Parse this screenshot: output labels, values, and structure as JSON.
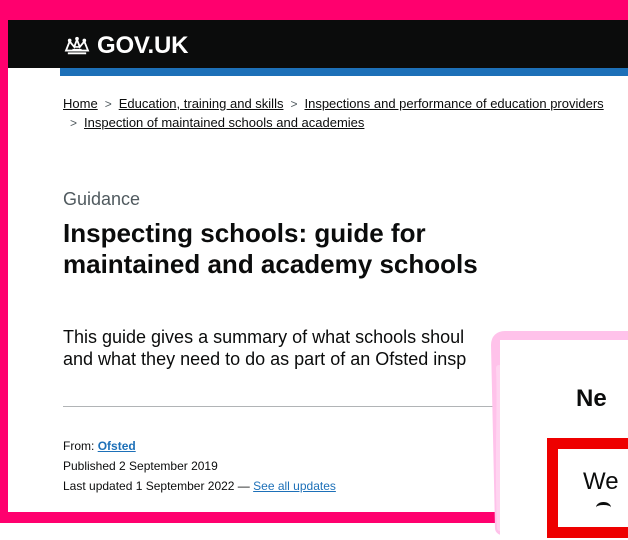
{
  "colors": {
    "frame": "#ff006e",
    "header": "#0b0c0c",
    "header_accent": "#1d70b8",
    "link": "#1d70b8",
    "popup_outline": "#ffc2ea",
    "popup_box_border": "#ee0000"
  },
  "header": {
    "logo_text": "GOV.UK",
    "logo_icon": "crown-icon"
  },
  "breadcrumbs": [
    "Home",
    "Education, training and skills",
    "Inspections and performance of education providers",
    "Inspection of maintained schools and academies"
  ],
  "document": {
    "type": "Guidance",
    "title": "Inspecting schools: guide for maintained and academy schools",
    "lead_line_1": "This guide gives a summary of what schools shoul",
    "lead_line_2": "and what they need to do as part of an Ofsted insp"
  },
  "meta": {
    "from_label": "From:",
    "from_value": "Ofsted",
    "published": "Published 2 September 2019",
    "last_updated": "Last updated 1 September 2022 —",
    "updates_link": "See all updates"
  },
  "popup": {
    "title": "Ne",
    "box_text": "We"
  }
}
